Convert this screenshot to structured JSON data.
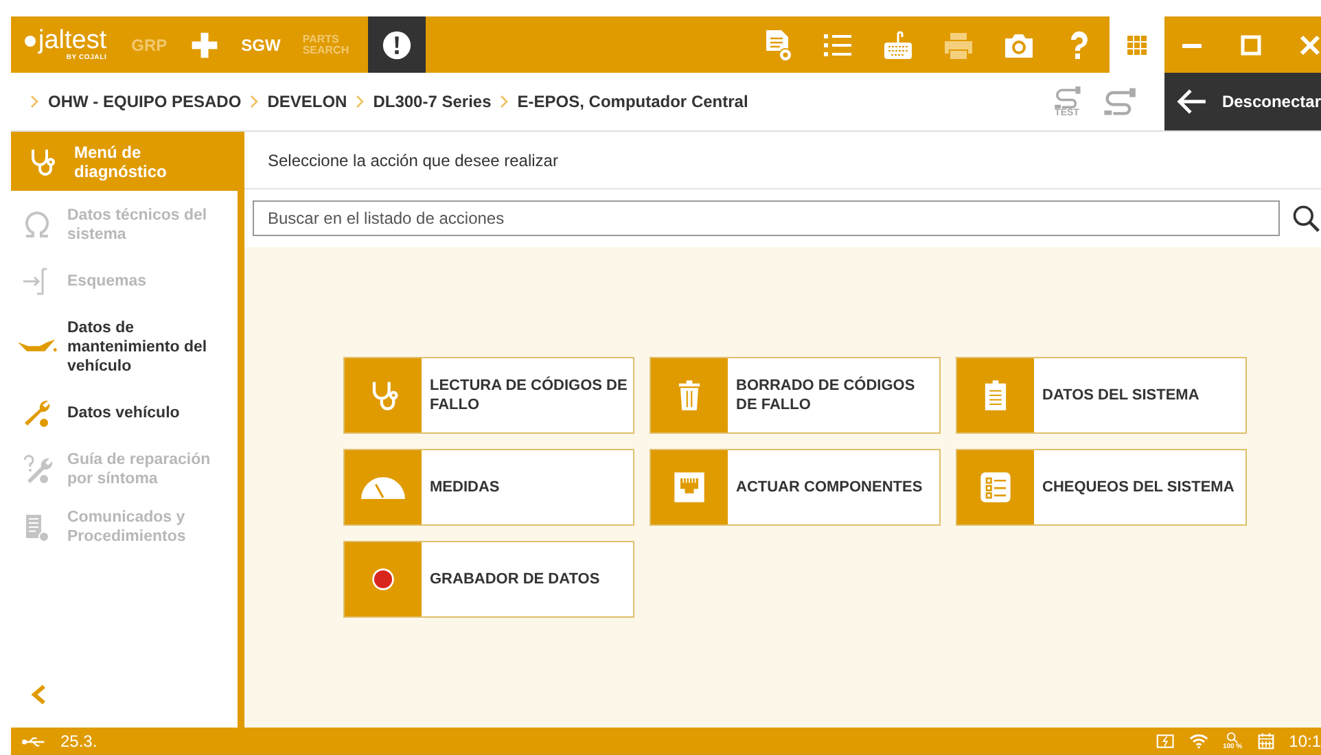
{
  "header": {
    "logo": {
      "name": "jaltest",
      "tagline": "BY COJALI"
    },
    "tools": [
      {
        "label": "GRP",
        "disabled": true
      },
      {
        "label": "SGW",
        "disabled": false
      },
      {
        "label": "PARTS SEARCH",
        "disabled": true
      }
    ]
  },
  "breadcrumb": [
    "OHW - EQUIPO PESADO",
    "DEVELON",
    "DL300-7 Series",
    "E-EPOS, Computador Central"
  ],
  "connection": {
    "test_label": "TEST",
    "disconnect": "Desconectar"
  },
  "sidebar": {
    "title": "Menú de diagnóstico",
    "items": [
      {
        "label": "Datos técnicos del sistema",
        "disabled": true
      },
      {
        "label": "Esquemas",
        "disabled": true
      },
      {
        "label": "Datos de mantenimiento del vehículo",
        "disabled": false
      },
      {
        "label": "Datos vehículo",
        "disabled": false
      },
      {
        "label": "Guía de reparación por síntoma",
        "disabled": true
      },
      {
        "label": "Comunicados y Procedimientos",
        "disabled": true
      }
    ]
  },
  "content": {
    "prompt": "Seleccione la acción que desee realizar",
    "search": {
      "placeholder": "Buscar en el listado de acciones"
    },
    "actions": [
      {
        "label": "LECTURA DE CÓDIGOS DE FALLO"
      },
      {
        "label": "BORRADO DE CÓDIGOS DE FALLO"
      },
      {
        "label": "DATOS DEL SISTEMA"
      },
      {
        "label": "MEDIDAS"
      },
      {
        "label": "ACTUAR COMPONENTES"
      },
      {
        "label": "CHEQUEOS DEL SISTEMA"
      },
      {
        "label": "GRABADOR DE DATOS"
      }
    ]
  },
  "status_bar": {
    "version": "25.3.",
    "zoom": "100 %",
    "time": "10:1"
  }
}
